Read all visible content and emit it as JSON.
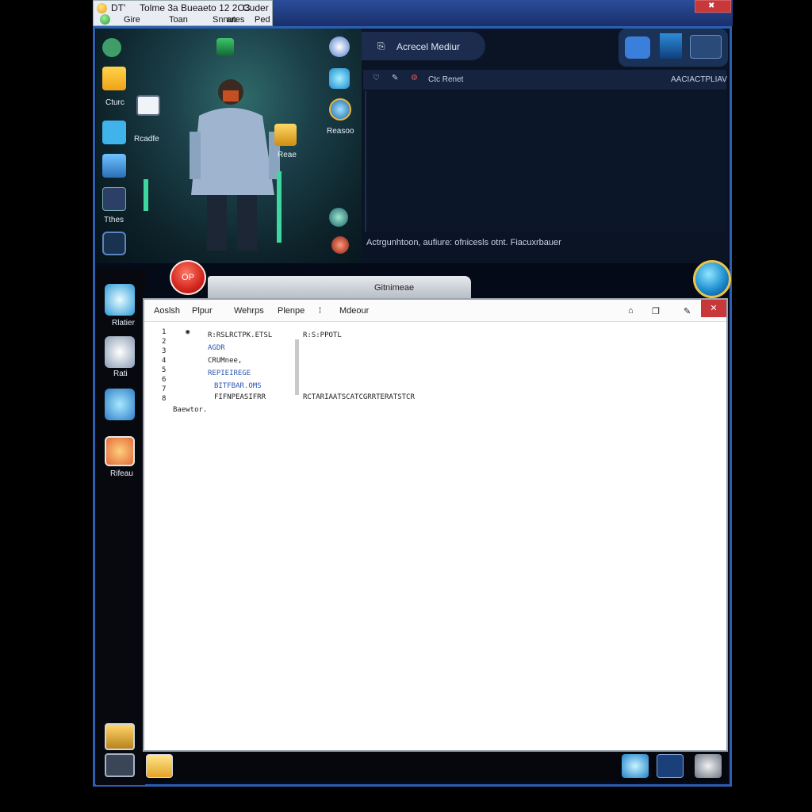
{
  "title_tag": {
    "line1a": "DT'",
    "line1b": "Tolme 3a Bueaeto 12 2O3",
    "line1c": "Cuder",
    "line2a": "Gire",
    "line2b": "Toan",
    "line2c": "Snnutes",
    "line2d": "an",
    "line2e": "Ped"
  },
  "game_view": {
    "left_icon_1_label": "Cturc",
    "left_icon_2_label": "Tthes",
    "center_label": "Rcadfe",
    "right_icon_label": "Reae",
    "far_right_label": "Reasoo"
  },
  "right_pane": {
    "tab_title": "Acrecel Mediur ",
    "bar_label": "Ctc Renet",
    "bar_right": "AACIACTPLIAV",
    "status": "Actrgunhtoon, aufiure: ofnicesls otnt. Fiacuxrbauer"
  },
  "left_dock": {
    "item1": "Rlatier",
    "item2": "Rati",
    "item3": "Rifeau"
  },
  "red_pill": {
    "label": "OP"
  },
  "explorer": {
    "tab_title": "Gitnimeae",
    "toolbar": [
      "Aoslsh",
      "Plpur",
      "Wehrps",
      "Plenpe",
      "Mdeour"
    ],
    "lines": [
      "R:RSLRCTPK.ETSL",
      "AGDR",
      "CRUMnee,",
      "REPIEIREGE",
      "BITFBAR.OMS",
      "FIFNPEASIFRR"
    ],
    "right_col_1": "R:S:PPOTL",
    "right_col_2": "RCTARIAATSCATCGRRTERATSTCR",
    "footer_line": "Baewtor.",
    "gutter_numbers": [
      "1",
      "2",
      "3",
      "4",
      "5",
      "6",
      "7",
      "8"
    ]
  }
}
